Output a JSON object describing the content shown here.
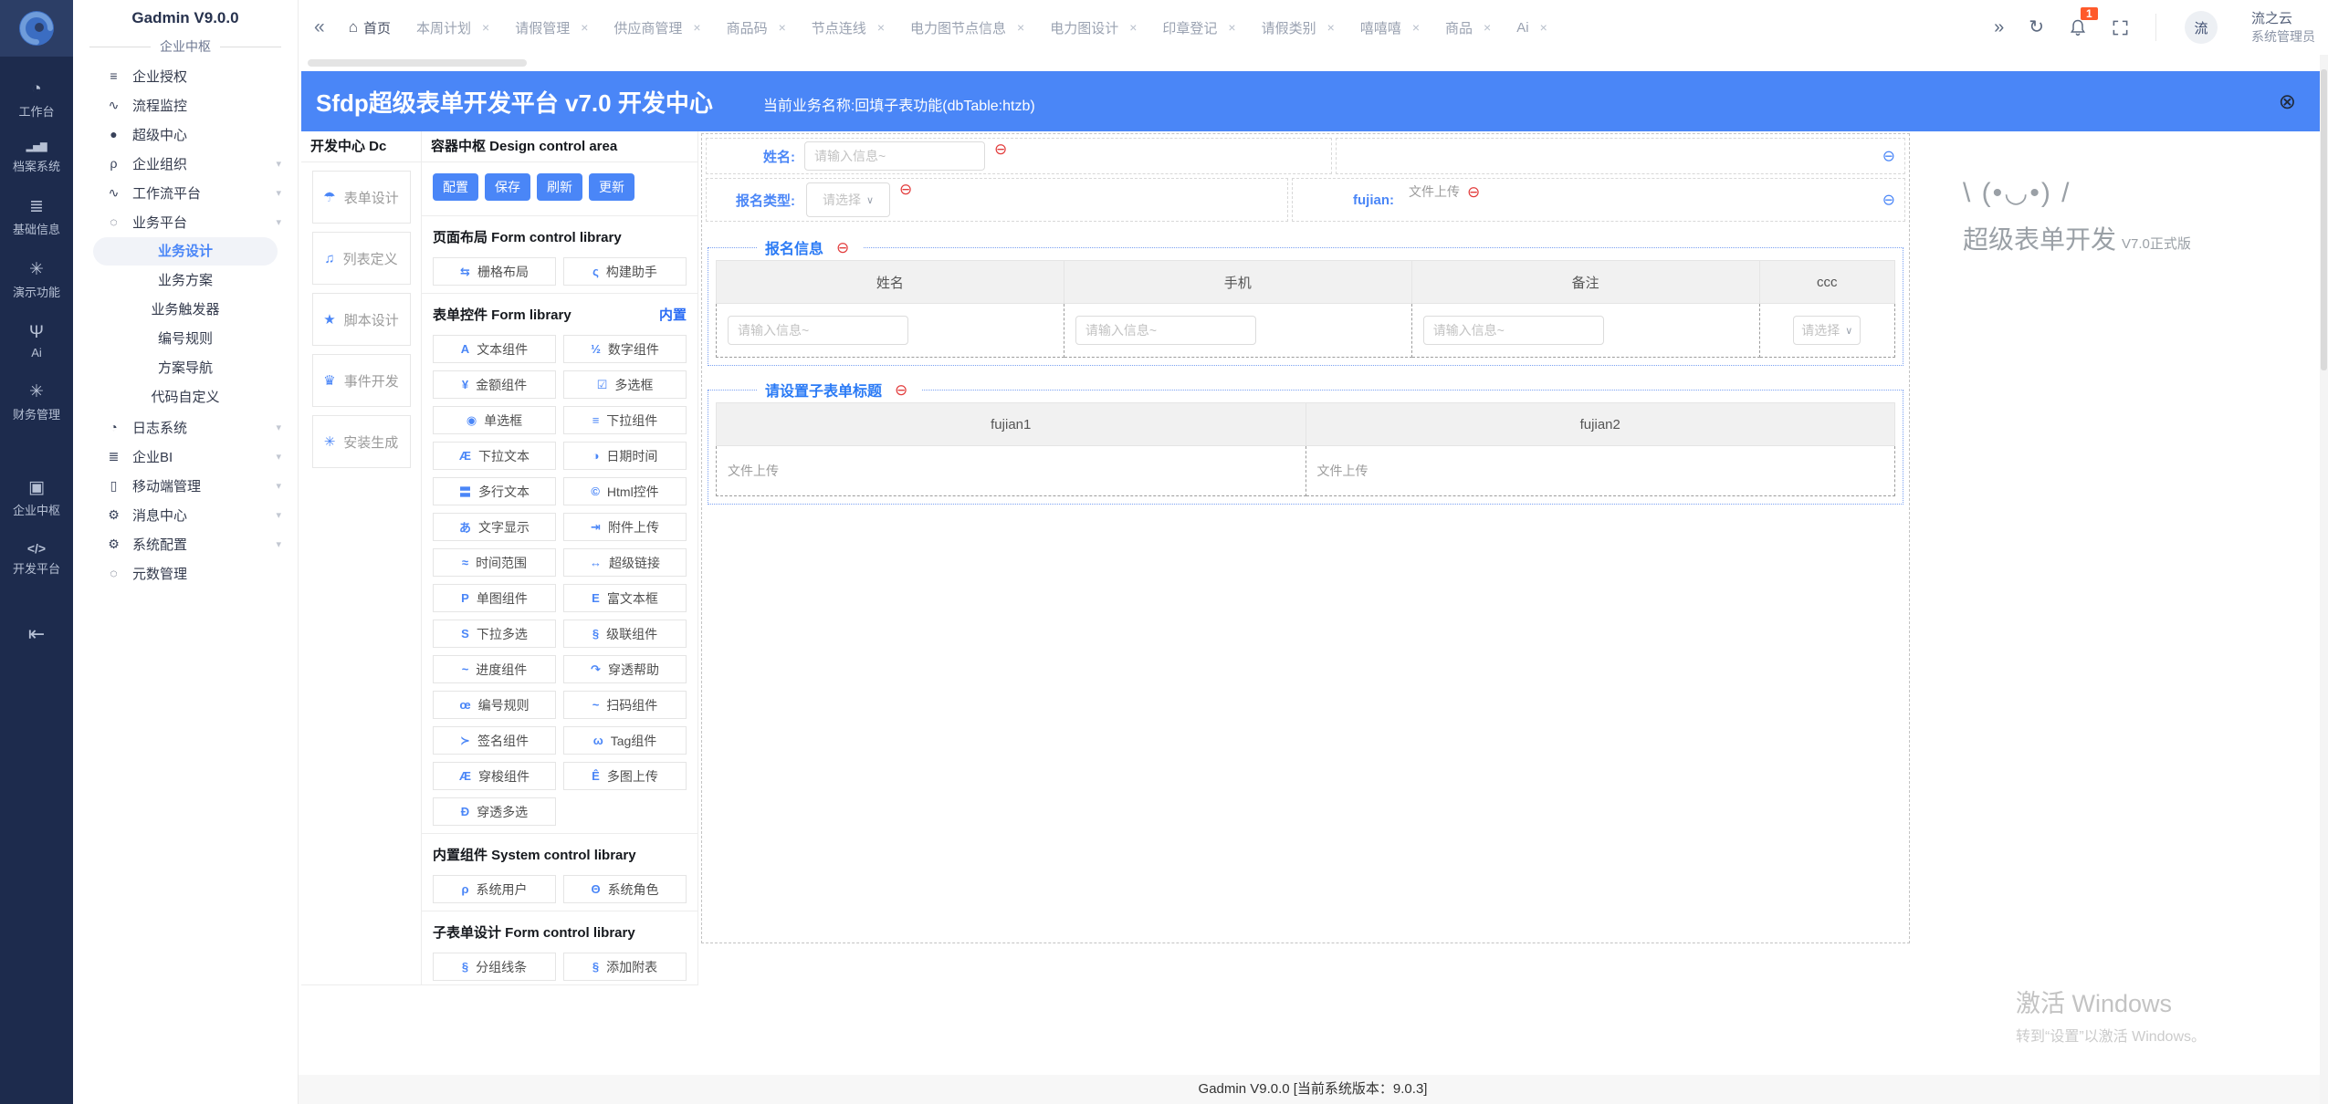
{
  "colors": {
    "accent": "#4a86f7",
    "section_blue": "#2a7af5",
    "badge_orange": "#ff5a2b",
    "rail_bg": "#1d2b4d",
    "remove_red": "#e23b3b"
  },
  "glyphs": {
    "remove": "⊖",
    "close_circle": "⊗",
    "left_arrow": "«",
    "right_arrow": "»",
    "refresh": "↻",
    "caret": "∨",
    "chevron": "▾",
    "close": "×",
    "home": "⌂"
  },
  "rail": {
    "items": [
      {
        "id": "workbench",
        "icon_name": "dashboard-icon",
        "glyph": "◔",
        "label": "工作台"
      },
      {
        "id": "archive-system",
        "icon_name": "bar-chart-icon",
        "glyph": "▂▅▇",
        "label": "档案系统"
      },
      {
        "id": "basic-info",
        "icon_name": "list-icon",
        "glyph": "≣",
        "label": "基础信息"
      },
      {
        "id": "demo-features",
        "icon_name": "snowflake-icon",
        "glyph": "✳",
        "label": "演示功能"
      },
      {
        "id": "ai",
        "icon_name": "palm-tree-icon",
        "glyph": "Ψ",
        "label": "Ai"
      },
      {
        "id": "finance-management",
        "icon_name": "snowflake-icon",
        "glyph": "✳",
        "label": "财务管理"
      },
      {
        "id": "enterprise-hub",
        "icon_name": "blocks-icon",
        "glyph": "▣",
        "label": "企业中枢",
        "gap": true
      },
      {
        "id": "dev-platform",
        "icon_name": "code-icon",
        "glyph": "</>",
        "label": "开发平台"
      }
    ]
  },
  "sidebar": {
    "title": "Gadmin V9.0.0",
    "section": "企业中枢",
    "items": [
      {
        "id": "enterprise-auth",
        "icon_name": "sliders-icon",
        "glyph": "≡",
        "label": "企业授权"
      },
      {
        "id": "process-monitor",
        "icon_name": "pulse-icon",
        "glyph": "∿",
        "label": "流程监控"
      },
      {
        "id": "super-center",
        "icon_name": "dot-icon",
        "glyph": "●",
        "label": "超级中心"
      },
      {
        "id": "enterprise-org",
        "icon_name": "person-icon",
        "glyph": "ρ",
        "label": "企业组织",
        "arrow": true
      },
      {
        "id": "workflow-platform",
        "icon_name": "pulse-icon",
        "glyph": "∿",
        "label": "工作流平台",
        "arrow": true
      },
      {
        "id": "business-platform",
        "icon_name": "dashed-circle-icon",
        "glyph": "◌",
        "label": "业务平台",
        "arrow": true,
        "children": [
          {
            "id": "business-design",
            "label": "业务设计",
            "active": true
          },
          {
            "id": "business-plan",
            "label": "业务方案"
          },
          {
            "id": "business-trigger",
            "label": "业务触发器"
          },
          {
            "id": "numbering-rule",
            "label": "编号规则"
          },
          {
            "id": "plan-navigation",
            "label": "方案导航"
          },
          {
            "id": "code-custom",
            "label": "代码自定义"
          }
        ]
      },
      {
        "id": "log-system",
        "icon_name": "clock-icon",
        "glyph": "◔",
        "label": "日志系统",
        "arrow": true
      },
      {
        "id": "enterprise-bi",
        "icon_name": "lines-icon",
        "glyph": "≣",
        "label": "企业BI",
        "arrow": true
      },
      {
        "id": "mobile-management",
        "icon_name": "phone-icon",
        "glyph": "▯",
        "label": "移动端管理",
        "arrow": true
      },
      {
        "id": "message-center",
        "icon_name": "gear-icon",
        "glyph": "⚙",
        "label": "消息中心",
        "arrow": true
      },
      {
        "id": "system-config",
        "icon_name": "gear-icon",
        "glyph": "⚙",
        "label": "系统配置",
        "arrow": true
      },
      {
        "id": "metadata-management",
        "icon_name": "dashed-circle-icon",
        "glyph": "◌",
        "label": "元数管理"
      }
    ]
  },
  "tabbar": {
    "home_tab": "首页",
    "tabs": [
      "本周计划",
      "请假管理",
      "供应商管理",
      "商品码",
      "节点连线",
      "电力图节点信息",
      "电力图设计",
      "印章登记",
      "请假类别",
      "嘻嘻嘻",
      "商品",
      "Ai"
    ],
    "badge": "1",
    "user": {
      "avatar": "流",
      "name": "流之云",
      "role": "系统管理员"
    }
  },
  "designer": {
    "header": {
      "title": "Sfdp超级表单开发平台 v7.0 开发中心",
      "subtitle": "当前业务名称:回填子表功能(dbTable:htzb)"
    },
    "dc_panel": {
      "title": "开发中心 Dc",
      "items": [
        {
          "id": "form-design",
          "glyph": "☂",
          "label": "表单设计"
        },
        {
          "id": "list-define",
          "glyph": "♫",
          "label": "列表定义"
        },
        {
          "id": "script-design",
          "glyph": "★",
          "label": "脚本设计"
        },
        {
          "id": "event-dev",
          "glyph": "♛",
          "label": "事件开发"
        },
        {
          "id": "install-generate",
          "glyph": "✳",
          "label": "安装生成"
        }
      ]
    },
    "control_panel": {
      "title": "容器中枢 Design control area",
      "buttons": [
        "配置",
        "保存",
        "刷新",
        "更新"
      ],
      "layout_section": {
        "title": "页面布局 Form control library",
        "items": [
          {
            "id": "grid-layout",
            "glyph": "⇆",
            "label": "栅格布局"
          },
          {
            "id": "build-assistant",
            "glyph": "ς",
            "label": "构建助手"
          }
        ]
      },
      "form_section": {
        "title": "表单控件 Form library",
        "badge": "内置",
        "items": [
          {
            "id": "text",
            "glyph": "A",
            "label": "文本组件"
          },
          {
            "id": "number",
            "glyph": "½",
            "label": "数字组件"
          },
          {
            "id": "money",
            "glyph": "¥",
            "label": "金额组件"
          },
          {
            "id": "checkbox",
            "glyph": "☑",
            "label": "多选框"
          },
          {
            "id": "radio",
            "glyph": "◉",
            "label": "单选框"
          },
          {
            "id": "select",
            "glyph": "≡",
            "label": "下拉组件"
          },
          {
            "id": "select-text",
            "glyph": "Æ",
            "label": "下拉文本"
          },
          {
            "id": "datetime",
            "glyph": "◑",
            "label": "日期时间"
          },
          {
            "id": "textarea",
            "glyph": "〓",
            "label": "多行文本"
          },
          {
            "id": "html",
            "glyph": "©",
            "label": "Html控件"
          },
          {
            "id": "text-display",
            "glyph": "あ",
            "label": "文字显示"
          },
          {
            "id": "attachment-upload",
            "glyph": "⇥",
            "label": "附件上传"
          },
          {
            "id": "time-range",
            "glyph": "≈",
            "label": "时间范围"
          },
          {
            "id": "hyperlink",
            "glyph": "↔",
            "label": "超级链接"
          },
          {
            "id": "single-image",
            "glyph": "P",
            "label": "单图组件"
          },
          {
            "id": "richtext",
            "glyph": "E",
            "label": "富文本框"
          },
          {
            "id": "multi-select",
            "glyph": "S",
            "label": "下拉多选"
          },
          {
            "id": "cascade",
            "glyph": "§",
            "label": "级联组件"
          },
          {
            "id": "progress",
            "glyph": "~",
            "label": "进度组件"
          },
          {
            "id": "drill-help",
            "glyph": "↷",
            "label": "穿透帮助"
          },
          {
            "id": "numbering-rule",
            "glyph": "œ",
            "label": "编号规则"
          },
          {
            "id": "scan",
            "glyph": "~",
            "label": "扫码组件"
          },
          {
            "id": "signature",
            "glyph": "≻",
            "label": "签名组件"
          },
          {
            "id": "tag",
            "glyph": "ω",
            "label": "Tag组件"
          },
          {
            "id": "transfer",
            "glyph": "Æ",
            "label": "穿梭组件"
          },
          {
            "id": "multi-image-upload",
            "glyph": "Ê",
            "label": "多图上传"
          },
          {
            "id": "drill-multiselect",
            "glyph": "Ð",
            "label": "穿透多选"
          }
        ]
      },
      "system_section": {
        "title": "内置组件 System control library",
        "items": [
          {
            "id": "system-user",
            "glyph": "ρ",
            "label": "系统用户"
          },
          {
            "id": "system-role",
            "glyph": "Θ",
            "label": "系统角色"
          }
        ]
      },
      "subform_section": {
        "title": "子表单设计 Form control library",
        "items": [
          {
            "id": "group-line",
            "glyph": "§",
            "label": "分组线条"
          },
          {
            "id": "add-subtable",
            "glyph": "§",
            "label": "添加附表"
          }
        ]
      }
    },
    "canvas": {
      "field_name": {
        "label": "姓名:",
        "placeholder": "请输入信息~"
      },
      "field_type": {
        "label": "报名类型:",
        "placeholder": "请选择"
      },
      "field_fujian": {
        "label": "fujian:",
        "upload_text": "文件上传"
      },
      "section_baoming": {
        "title": "报名信息",
        "columns": [
          "姓名",
          "手机",
          "备注",
          "ccc"
        ],
        "input_placeholder": "请输入信息~",
        "select_placeholder": "请选择"
      },
      "section_subform": {
        "title": "请设置子表单标题",
        "columns": [
          "fujian1",
          "fujian2"
        ],
        "cell_text": "文件上传"
      }
    },
    "right_panel": {
      "emoticon": "\\ (•◡•) /",
      "title": "超级表单开发",
      "version": "V7.0正式版"
    }
  },
  "watermark": {
    "line1": "激活 Windows",
    "line2": "转到“设置”以激活 Windows。"
  },
  "footer": "Gadmin V9.0.0 [当前系统版本：9.0.3]"
}
